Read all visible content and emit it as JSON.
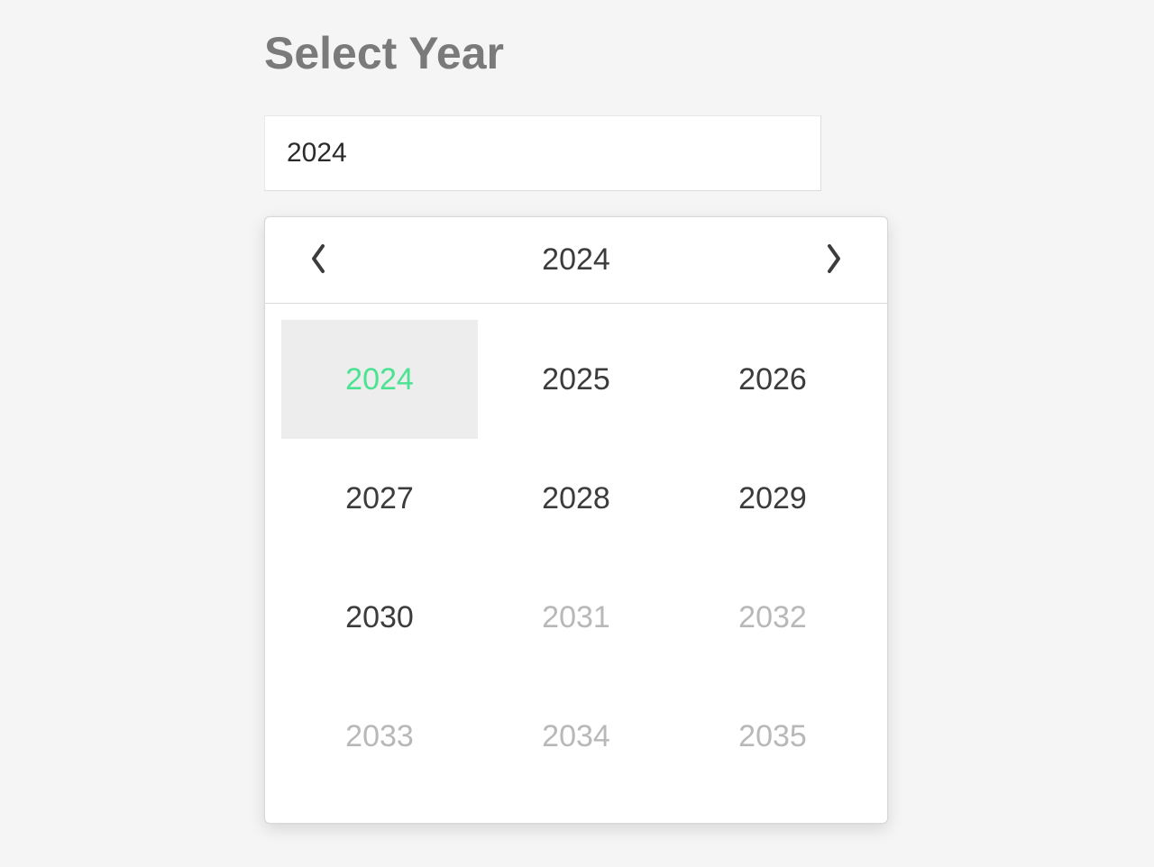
{
  "title": "Select Year",
  "input": {
    "value": "2024"
  },
  "picker": {
    "headerYear": "2024",
    "years": [
      {
        "label": "2024",
        "state": "selected"
      },
      {
        "label": "2025",
        "state": "normal"
      },
      {
        "label": "2026",
        "state": "normal"
      },
      {
        "label": "2027",
        "state": "normal"
      },
      {
        "label": "2028",
        "state": "normal"
      },
      {
        "label": "2029",
        "state": "normal"
      },
      {
        "label": "2030",
        "state": "normal"
      },
      {
        "label": "2031",
        "state": "disabled"
      },
      {
        "label": "2032",
        "state": "disabled"
      },
      {
        "label": "2033",
        "state": "disabled"
      },
      {
        "label": "2034",
        "state": "disabled"
      },
      {
        "label": "2035",
        "state": "disabled"
      }
    ]
  }
}
